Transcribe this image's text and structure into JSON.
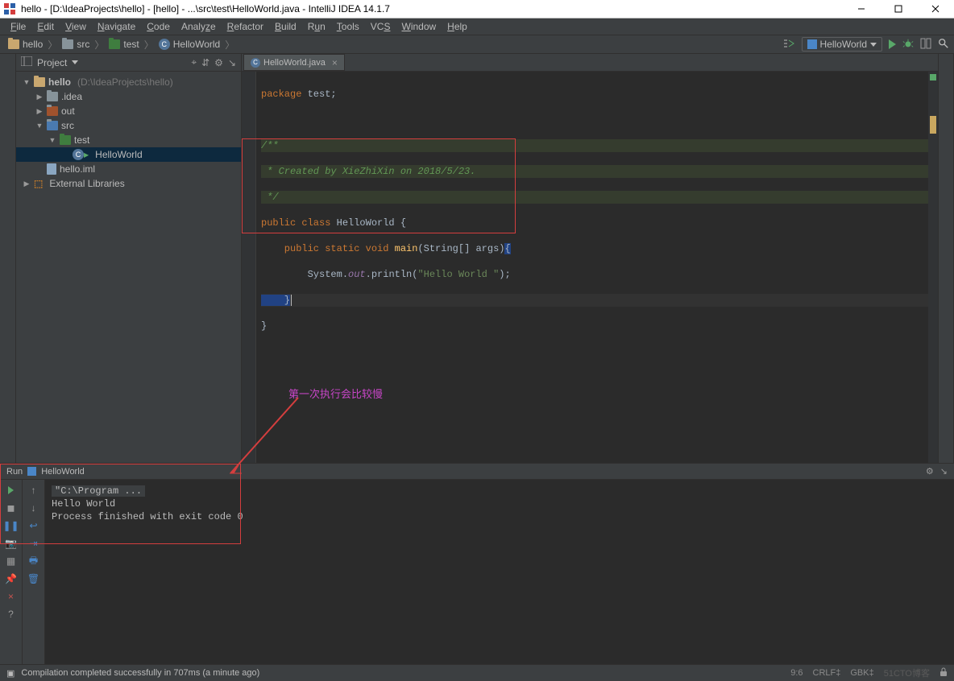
{
  "title": "hello - [D:\\IdeaProjects\\hello] - [hello] - ...\\src\\test\\HelloWorld.java - IntelliJ IDEA 14.1.7",
  "menu": [
    "File",
    "Edit",
    "View",
    "Navigate",
    "Code",
    "Analyze",
    "Refactor",
    "Build",
    "Run",
    "Tools",
    "VCS",
    "Window",
    "Help"
  ],
  "breadcrumbs": {
    "items": [
      {
        "icon": "proj",
        "label": "hello"
      },
      {
        "icon": "folder",
        "label": "src"
      },
      {
        "icon": "test",
        "label": "test"
      },
      {
        "icon": "class",
        "label": "HelloWorld"
      }
    ]
  },
  "run_config": "HelloWorld",
  "project": {
    "title": "Project",
    "nodes": {
      "root": {
        "label": "hello",
        "hint": "(D:\\IdeaProjects\\hello)"
      },
      "idea": ".idea",
      "out": "out",
      "src": "src",
      "test": "test",
      "hw": "HelloWorld",
      "iml": "hello.iml",
      "ext": "External Libraries"
    }
  },
  "editor": {
    "tab": "HelloWorld.java",
    "lines": {
      "l1a": "package ",
      "l1b": "test",
      "l1c": ";",
      "l3": "/**",
      "l4": " * Created by XieZhiXin on 2018/5/23.",
      "l5": " */",
      "l6a": "public class ",
      "l6b": "HelloWorld {",
      "l7a": "    public static void ",
      "l7b": "main",
      "l7c": "(String[] args)",
      "l7d": "{",
      "l8a": "        System.",
      "l8b": "out",
      "l8c": ".println(",
      "l8d": "\"Hello World \"",
      "l8e": ");",
      "l9": "    }",
      "l10": "}"
    }
  },
  "annotation": "第一次执行会比较慢",
  "run": {
    "title": "Run",
    "name": "HelloWorld",
    "lines": {
      "cmd": "\"C:\\Program ...",
      "out": "Hello World",
      "exit": "Process finished with exit code 0"
    }
  },
  "status": {
    "msg": "Compilation completed successfully in 707ms (a minute ago)",
    "pos": "9:6",
    "eol": "CRLF‡",
    "enc": "GBK‡",
    "watermark": "51CTO博客"
  }
}
